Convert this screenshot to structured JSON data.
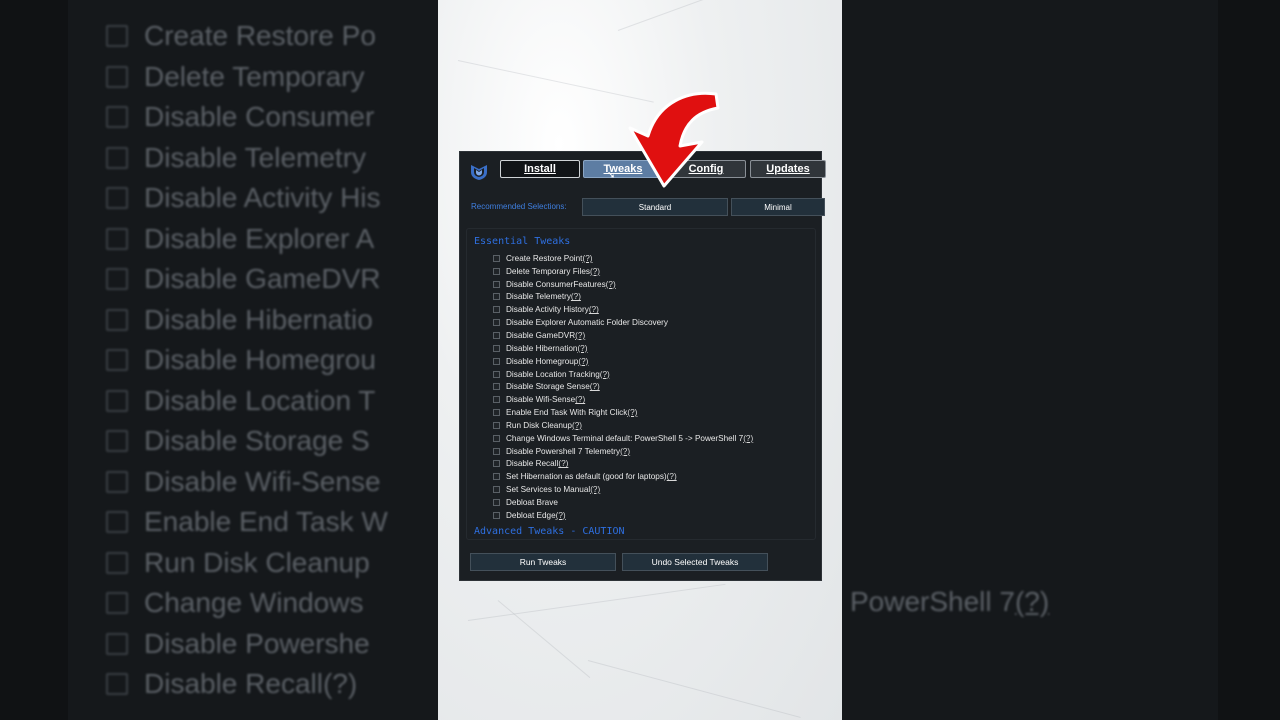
{
  "background": {
    "left_items": [
      "Create Restore Po",
      "Delete Temporary",
      "Disable Consumer",
      "Disable Telemetry",
      "Disable Activity His",
      "Disable Explorer A",
      "Disable GameDVR",
      "Disable Hibernatio",
      "Disable Homegrou",
      "Disable Location T",
      "Disable Storage S",
      "Disable Wifi-Sense",
      "Enable End Task W",
      "Run Disk Cleanup",
      "Change Windows",
      "Disable Powershe",
      "Disable Recall(?)"
    ],
    "right_text": "PowerShell 7",
    "right_help": "(?)"
  },
  "app": {
    "tabs": {
      "install": "Install",
      "tweaks": "Tweaks",
      "config": "Config",
      "updates": "Updates"
    },
    "recommended_label": "Recommended Selections:",
    "recommended_standard": "Standard",
    "recommended_minimal": "Minimal",
    "essential_title": "Essential Tweaks",
    "advanced_title": "Advanced Tweaks - CAUTION",
    "run_button": "Run Tweaks",
    "undo_button": "Undo Selected Tweaks",
    "help_mark": "(?)",
    "items": [
      {
        "label": "Create Restore Point",
        "help": "(?)"
      },
      {
        "label": "Delete Temporary Files",
        "help": "(?)"
      },
      {
        "label": "Disable ConsumerFeatures",
        "help": "(?)"
      },
      {
        "label": "Disable Telemetry",
        "help": "(?)"
      },
      {
        "label": "Disable Activity History",
        "help": "(?)"
      },
      {
        "label": "Disable Explorer Automatic Folder Discovery",
        "help": ""
      },
      {
        "label": "Disable GameDVR",
        "help": "(?)"
      },
      {
        "label": "Disable Hibernation",
        "help": "(?)"
      },
      {
        "label": "Disable Homegroup",
        "help": "(?)"
      },
      {
        "label": "Disable Location Tracking",
        "help": "(?)"
      },
      {
        "label": "Disable Storage Sense",
        "help": "(?)"
      },
      {
        "label": "Disable Wifi-Sense",
        "help": "(?)"
      },
      {
        "label": "Enable End Task With Right Click",
        "help": "(?)"
      },
      {
        "label": "Run Disk Cleanup",
        "help": "(?)"
      },
      {
        "label": "Change Windows Terminal default: PowerShell 5 -> PowerShell 7",
        "help": "(?)"
      },
      {
        "label": "Disable Powershell 7 Telemetry",
        "help": "(?)"
      },
      {
        "label": "Disable Recall",
        "help": "(?)"
      },
      {
        "label": "Set Hibernation as default (good for laptops)",
        "help": "(?)"
      },
      {
        "label": "Set Services to Manual",
        "help": "(?)"
      },
      {
        "label": "Debloat Brave",
        "help": ""
      },
      {
        "label": "Debloat Edge",
        "help": "(?)"
      }
    ]
  },
  "colors": {
    "accent_blue": "#2e6fe0",
    "arrow_red": "#e01010",
    "active_tab": "#5d7da3"
  },
  "icons": {
    "logo": "winutil-logo-icon",
    "arrow": "red-curved-arrow-icon",
    "cursor": "mouse-cursor-icon"
  }
}
